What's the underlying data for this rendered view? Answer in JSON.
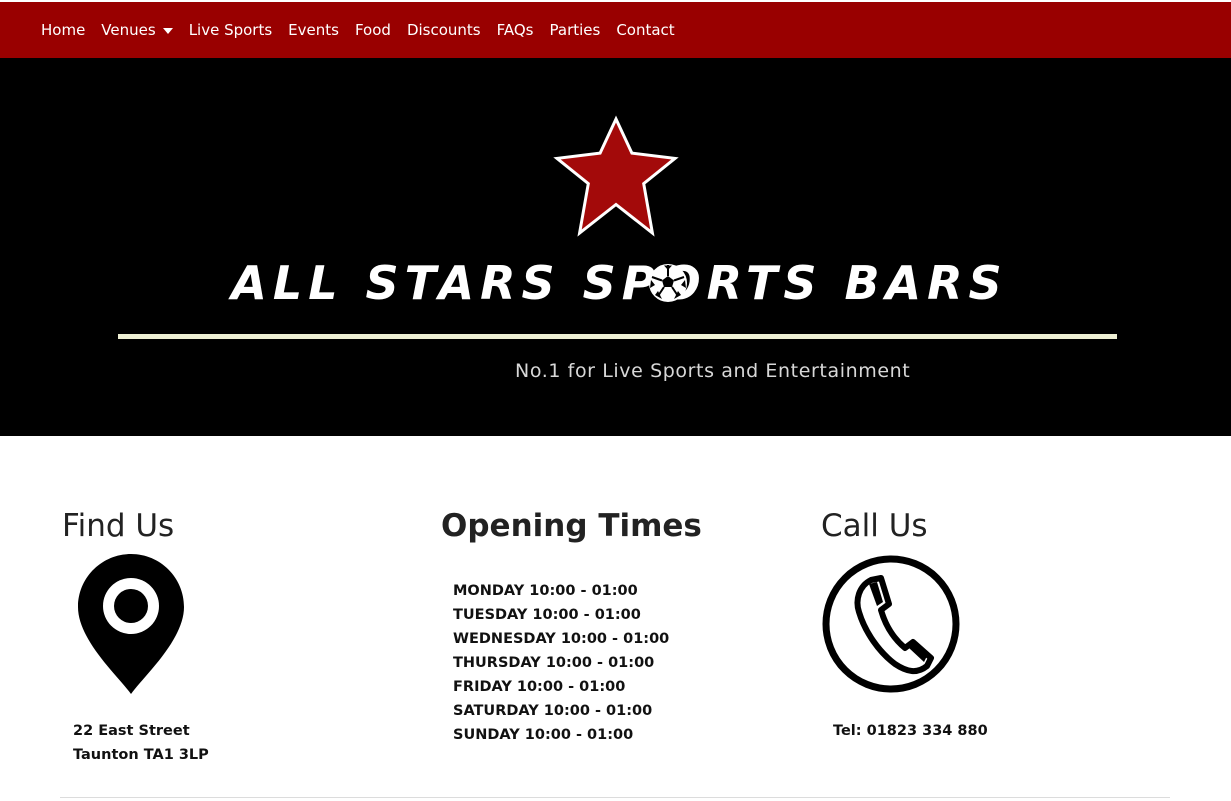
{
  "nav": {
    "items": [
      {
        "label": "Home",
        "name": "nav-home",
        "dropdown": false
      },
      {
        "label": "Venues",
        "name": "nav-venues",
        "dropdown": true
      },
      {
        "label": "Live Sports",
        "name": "nav-live-sports",
        "dropdown": false
      },
      {
        "label": "Events",
        "name": "nav-events",
        "dropdown": false
      },
      {
        "label": "Food",
        "name": "nav-food",
        "dropdown": false
      },
      {
        "label": "Discounts",
        "name": "nav-discounts",
        "dropdown": false
      },
      {
        "label": "FAQs",
        "name": "nav-faqs",
        "dropdown": false
      },
      {
        "label": "Parties",
        "name": "nav-parties",
        "dropdown": false
      },
      {
        "label": "Contact",
        "name": "nav-contact",
        "dropdown": false
      }
    ]
  },
  "hero": {
    "brand": "ALL STARS SPORTS BARS",
    "tagline": "No.1 for Live Sports and Entertainment",
    "icons": [
      "star-icon",
      "football-icon"
    ]
  },
  "find_us": {
    "heading": "Find Us",
    "icon": "map-pin-icon",
    "address_line1": "22 East Street",
    "address_line2": "Taunton TA1 3LP"
  },
  "opening_times": {
    "heading": "Opening Times",
    "days": [
      "MONDAY 10:00 - 01:00",
      "TUESDAY 10:00 - 01:00",
      "WEDNESDAY 10:00 - 01:00",
      "THURSDAY 10:00 - 01:00",
      "FRIDAY 10:00 - 01:00",
      "SATURDAY 10:00 - 01:00",
      "SUNDAY 10:00 - 01:00"
    ]
  },
  "call_us": {
    "heading": "Call Us",
    "icon": "phone-icon",
    "tel": "Tel: 01823 334 880"
  },
  "colors": {
    "nav_bg": "#990000",
    "hero_bg": "#000000",
    "star_fill": "#a30a0a",
    "rule": "#eef0d4"
  }
}
